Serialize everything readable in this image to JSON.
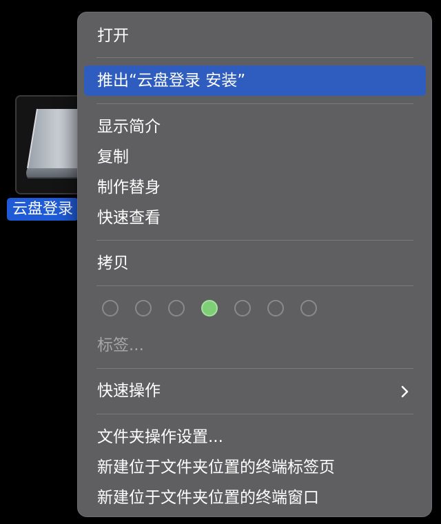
{
  "desktop": {
    "disk_label": "云盘登录",
    "disk_icon": "external-drive-icon"
  },
  "menu": {
    "open": "打开",
    "eject": "推出“云盘登录 安装”",
    "get_info": "显示简介",
    "duplicate": "复制",
    "make_alias": "制作替身",
    "quick_look": "快速查看",
    "copy": "拷贝",
    "tags_label": "标签...",
    "quick_actions": "快速操作",
    "folder_actions_setup": "文件夹操作设置...",
    "new_terminal_tab": "新建位于文件夹位置的终端标签页",
    "new_terminal_window": "新建位于文件夹位置的终端窗口"
  },
  "tag_colors": [
    "none",
    "none",
    "none",
    "green",
    "none",
    "none",
    "none"
  ],
  "colors": {
    "highlight": "#2e5dbf",
    "selection_label": "#1f5bd6",
    "menu_background": "#5f5f61",
    "green_tag": "#7fcf78"
  }
}
